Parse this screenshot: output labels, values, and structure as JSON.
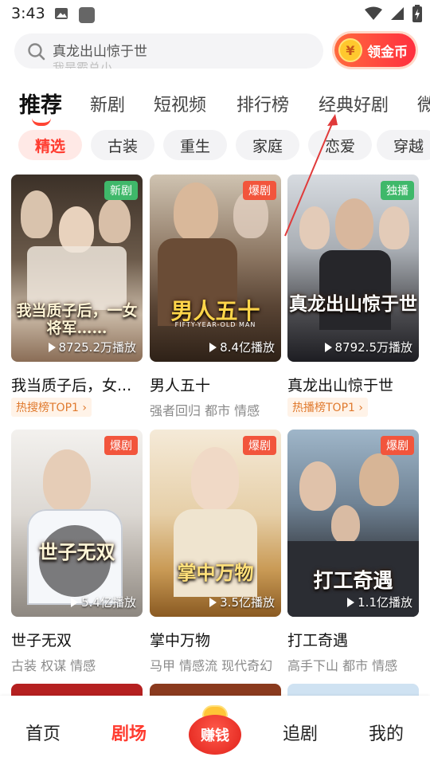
{
  "status_bar": {
    "time": "3:43",
    "icons_left": [
      "image-icon",
      "app-icon"
    ],
    "icons_right": [
      "wifi-icon",
      "signal-icon",
      "battery-icon"
    ]
  },
  "search": {
    "text": "真龙出山惊于世",
    "next_text": "我是霸总小"
  },
  "coin_button": {
    "icon_text": "¥",
    "label": "领金币"
  },
  "tabs": [
    {
      "label": "推荐",
      "active": true
    },
    {
      "label": "新剧"
    },
    {
      "label": "短视频"
    },
    {
      "label": "排行榜"
    },
    {
      "label": "经典好剧"
    },
    {
      "label": "微"
    }
  ],
  "chips": [
    {
      "label": "精选",
      "active": true
    },
    {
      "label": "古装"
    },
    {
      "label": "重生"
    },
    {
      "label": "家庭"
    },
    {
      "label": "恋爱"
    },
    {
      "label": "穿越"
    }
  ],
  "cards": [
    {
      "poster_title": "我当质子后，一女将军……",
      "badge": "新剧",
      "plays": "8725.2万播放",
      "title": "我当质子后，女...",
      "rank": "热搜榜TOP1 ›",
      "tags": ""
    },
    {
      "poster_title": "男人五十",
      "poster_sub": "FIFTY-YEAR-OLD MAN",
      "badge": "爆剧",
      "plays": "8.4亿播放",
      "title": "男人五十",
      "rank": "",
      "tags": "强者回归 都市 情感"
    },
    {
      "poster_title": "真龙出山惊于世",
      "badge": "独播",
      "plays": "8792.5万播放",
      "title": "真龙出山惊于世",
      "rank": "热播榜TOP1 ›",
      "tags": ""
    },
    {
      "poster_title": "世子无双",
      "badge": "爆剧",
      "plays": "5.4亿播放",
      "title": "世子无双",
      "rank": "",
      "tags": "古装 权谋 情感"
    },
    {
      "poster_title": "掌中万物",
      "badge": "爆剧",
      "plays": "3.5亿播放",
      "title": "掌中万物",
      "rank": "",
      "tags": "马甲 情感流 现代奇幻"
    },
    {
      "poster_title": "打工奇遇",
      "badge": "爆剧",
      "plays": "1.1亿播放",
      "title": "打工奇遇",
      "rank": "",
      "tags": "高手下山 都市 情感"
    }
  ],
  "bottom_nav": {
    "home": "首页",
    "theater": "剧场",
    "earn": "赚钱",
    "follow": "追剧",
    "mine": "我的"
  },
  "colors": {
    "accent": "#ff3b2f",
    "badge_green": "#3fb86a",
    "badge_red": "#f2553c",
    "rank_orange": "#e07a2e"
  }
}
